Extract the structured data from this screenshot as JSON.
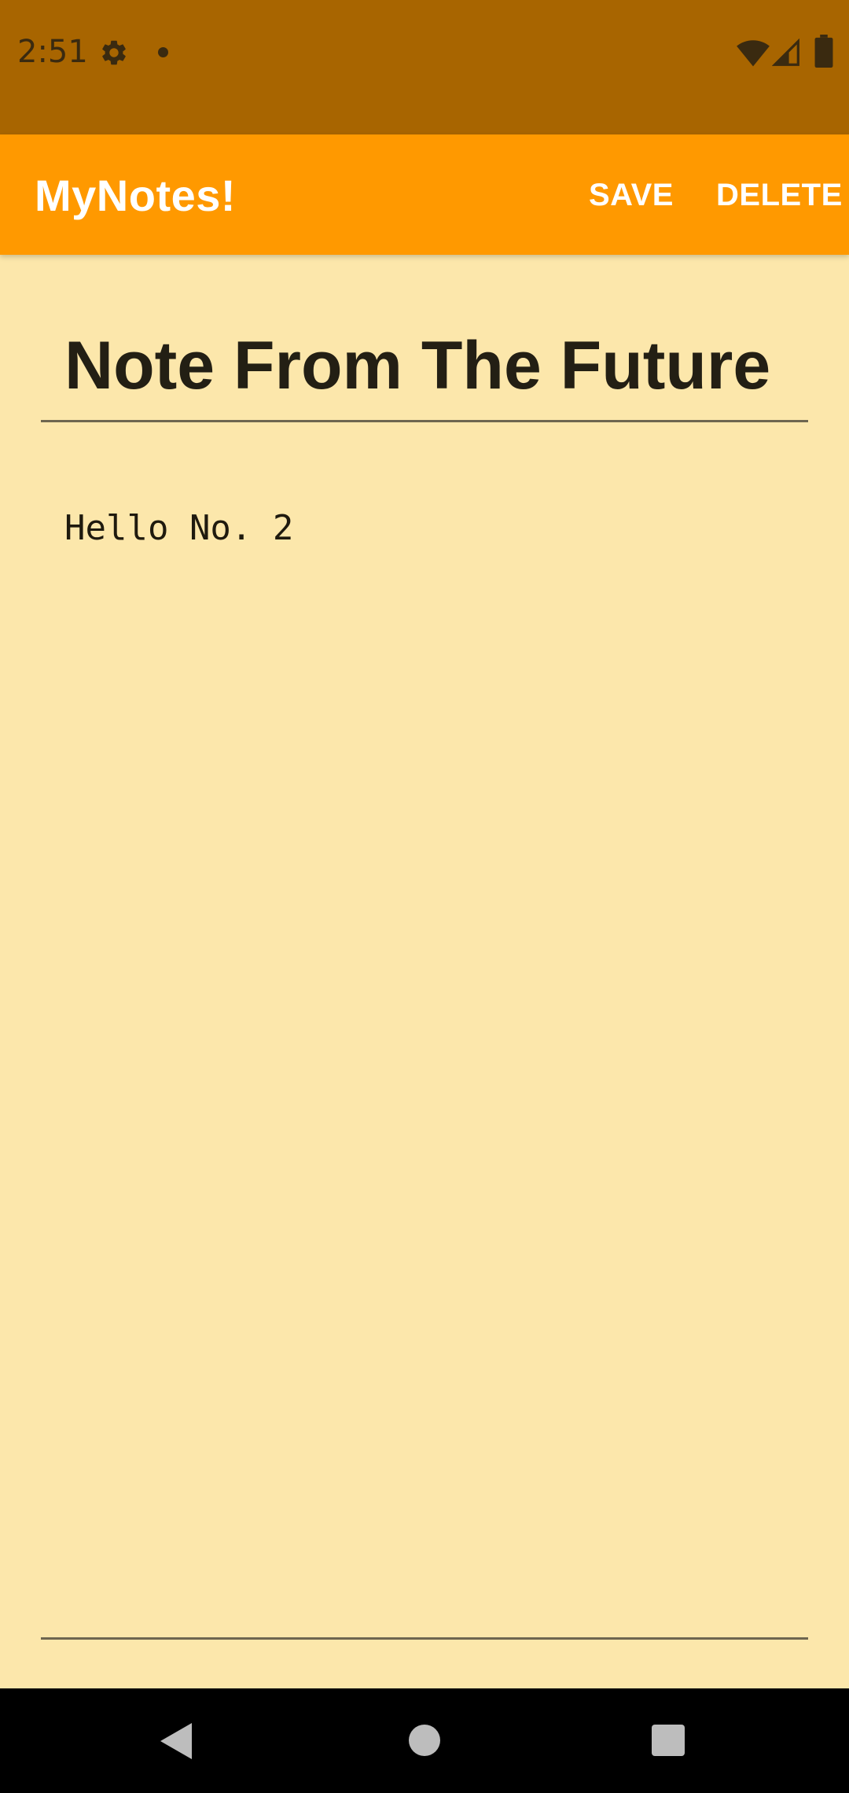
{
  "status_bar": {
    "time": "2:51",
    "icons": [
      "gear-icon",
      "notification-dot-icon",
      "wifi-icon",
      "signal-icon",
      "battery-icon"
    ]
  },
  "app_bar": {
    "title": "MyNotes!",
    "save_label": "SAVE",
    "delete_label": "DELETE"
  },
  "note": {
    "title": "Note From The Future",
    "body": "Hello No. 2"
  },
  "nav_bar": {
    "icons": [
      "back-icon",
      "home-icon",
      "recents-icon"
    ]
  },
  "colors": {
    "status_bar": "#A86500",
    "app_bar": "#FF9900",
    "background": "#FCE7AB",
    "nav_bar": "#000000"
  }
}
